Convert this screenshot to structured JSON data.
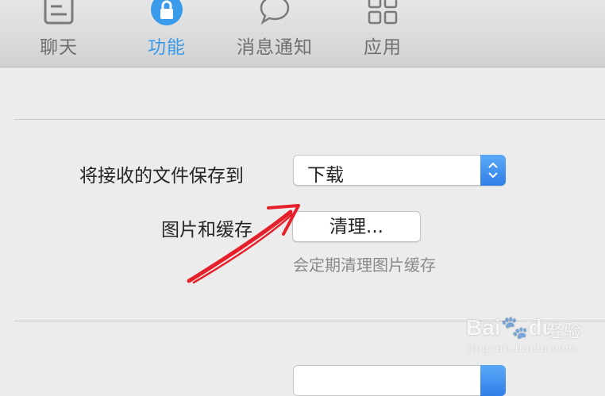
{
  "toolbar": {
    "tabs": [
      {
        "label": "聊天",
        "icon": "chat-window-icon",
        "active": false
      },
      {
        "label": "功能",
        "icon": "lock-icon",
        "active": true
      },
      {
        "label": "消息通知",
        "icon": "speech-bubble-icon",
        "active": false
      },
      {
        "label": "应用",
        "icon": "app-grid-icon",
        "active": false
      }
    ],
    "active_color": "#3a9bea"
  },
  "settings": {
    "save_to_label": "将接收的文件保存到",
    "save_to_value": "下载",
    "cache_label": "图片和缓存",
    "clean_button": "清理...",
    "clean_hint": "会定期清理图片缓存"
  },
  "watermark": {
    "brand": "Bai",
    "brand_suffix": "du",
    "jingyan": "经验",
    "url": "jingyan.baidu.com"
  },
  "colors": {
    "stepper": "#3b8cf0",
    "annotation_arrow": "#e5202a"
  }
}
